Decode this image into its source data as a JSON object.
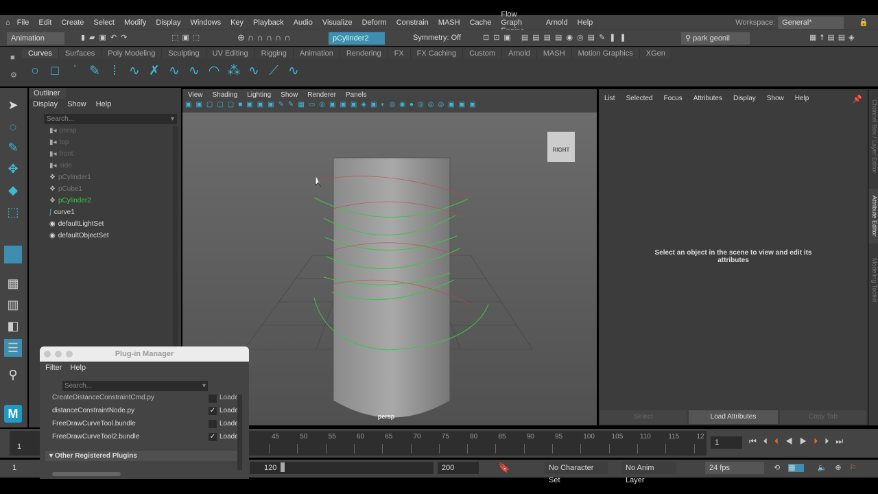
{
  "menubar": {
    "items": [
      "File",
      "Edit",
      "Create",
      "Select",
      "Modify",
      "Display",
      "Windows",
      "Key",
      "Playback",
      "Audio",
      "Visualize",
      "Deform",
      "Constrain",
      "MASH",
      "Cache",
      "Flow Graph Engine",
      "Arnold",
      "Help"
    ],
    "workspace_label": "Workspace:",
    "workspace_value": "General*"
  },
  "status": {
    "mode": "Animation",
    "object_field": "pCylinder2",
    "symmetry": "Symmetry: Off",
    "user": "park geonil"
  },
  "shelf": {
    "tabs": [
      "Curves",
      "Surfaces",
      "Poly Modeling",
      "Sculpting",
      "UV Editing",
      "Rigging",
      "Animation",
      "Rendering",
      "FX",
      "FX Caching",
      "Custom",
      "Arnold",
      "MASH",
      "Motion Graphics",
      "XGen"
    ],
    "active": "Curves"
  },
  "outliner": {
    "title": "Outliner",
    "menu": [
      "Display",
      "Show",
      "Help"
    ],
    "search_placeholder": "Search...",
    "items": [
      {
        "label": "persp",
        "type": "camera"
      },
      {
        "label": "top",
        "type": "camera"
      },
      {
        "label": "front",
        "type": "camera"
      },
      {
        "label": "side",
        "type": "camera"
      },
      {
        "label": "pCylinder1",
        "type": "mesh"
      },
      {
        "label": "pCube1",
        "type": "mesh"
      },
      {
        "label": "pCylinder2",
        "type": "mesh"
      },
      {
        "label": "curve1",
        "type": "curve"
      },
      {
        "label": "defaultLightSet",
        "type": "set"
      },
      {
        "label": "defaultObjectSet",
        "type": "set"
      }
    ]
  },
  "viewport": {
    "menu": [
      "View",
      "Shading",
      "Lighting",
      "Show",
      "Renderer",
      "Panels"
    ],
    "camera_label": "persp",
    "viewcube": "RIGHT"
  },
  "attribute_editor": {
    "menu": [
      "List",
      "Selected",
      "Focus",
      "Attributes",
      "Display",
      "Show",
      "Help"
    ],
    "message": "Select an object in the scene to view and edit its attributes",
    "buttons": [
      "Select",
      "Load Attributes",
      "Copy Tab"
    ]
  },
  "side_tabs": [
    "Channel Box / Layer Editor",
    "Attribute Editor",
    "Modeling Toolkit"
  ],
  "plugin_manager": {
    "title": "Plug-in Manager",
    "menu": [
      "Filter",
      "Help"
    ],
    "search_placeholder": "Search...",
    "rows": [
      {
        "name": "CreateDistanceConstraintCmd.py",
        "loaded": false
      },
      {
        "name": "distanceConstraintNode.py",
        "loaded": true
      },
      {
        "name": "FreeDrawCurveTool.bundle",
        "loaded": false
      },
      {
        "name": "FreeDrawCurveTool2.bundle",
        "loaded": true
      }
    ],
    "loaded_label": "Loade",
    "section": "Other Registered Plugins"
  },
  "timeline": {
    "ticks": [
      "45",
      "50",
      "55",
      "60",
      "65",
      "70",
      "75",
      "80",
      "85",
      "90",
      "95",
      "100",
      "105",
      "110",
      "115",
      "12"
    ],
    "start_frame": "1",
    "current_frame": "1"
  },
  "range": {
    "start": "1",
    "end": "120",
    "anim_end": "200",
    "character_set": "No Character Set",
    "anim_layer": "No Anim Layer",
    "fps": "24 fps"
  },
  "colors": {
    "accent": "#3fb8d6",
    "selected_green": "#3cc44a"
  }
}
